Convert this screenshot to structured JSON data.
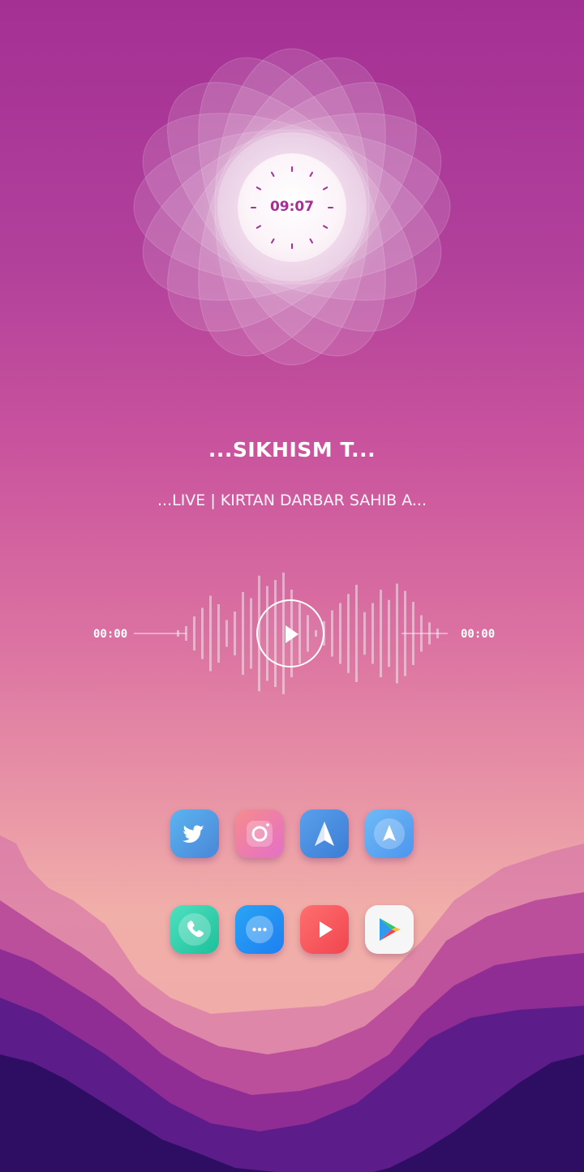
{
  "clock": {
    "time": "09:07"
  },
  "player": {
    "title": "...SIKHISM T...",
    "subtitle": "...LIVE | KIRTAN DARBAR SAHIB A...",
    "elapsed": "00:00",
    "duration": "00:00",
    "play_icon": "play-icon",
    "waveform_levels": [
      0.05,
      0.12,
      0.28,
      0.42,
      0.62,
      0.48,
      0.22,
      0.36,
      0.68,
      0.58,
      0.95,
      0.78,
      0.88,
      1.0,
      0.72,
      0.5,
      0.3,
      0.05,
      0.2,
      0.38,
      0.5,
      0.65,
      0.8,
      0.35,
      0.5,
      0.72,
      0.55,
      0.82,
      0.7,
      0.52,
      0.3,
      0.18,
      0.08
    ]
  },
  "dock": {
    "rows": [
      [
        {
          "name": "Twitter",
          "icon": "twitter-bird-icon",
          "color": "#4ea3e6"
        },
        {
          "name": "Instagram",
          "icon": "instagram-camera-icon",
          "color": "#f07a9a"
        },
        {
          "name": "Spark",
          "icon": "paper-plane-icon",
          "color": "#3f8ee0"
        },
        {
          "name": "Maps",
          "icon": "navigation-arrow-icon",
          "color": "#5fb0f5"
        }
      ],
      [
        {
          "name": "Phone",
          "icon": "phone-handset-icon",
          "color": "#2fd0b4"
        },
        {
          "name": "Messages",
          "icon": "chat-bubble-icon",
          "color": "#2a8ef0"
        },
        {
          "name": "YouTube",
          "icon": "play-triangle-icon",
          "color": "#ff5a62"
        },
        {
          "name": "Play Store",
          "icon": "play-store-icon",
          "color": "#f5f5f5"
        }
      ]
    ]
  },
  "colors": {
    "accent": "#a43094",
    "text": "#ffffff"
  }
}
